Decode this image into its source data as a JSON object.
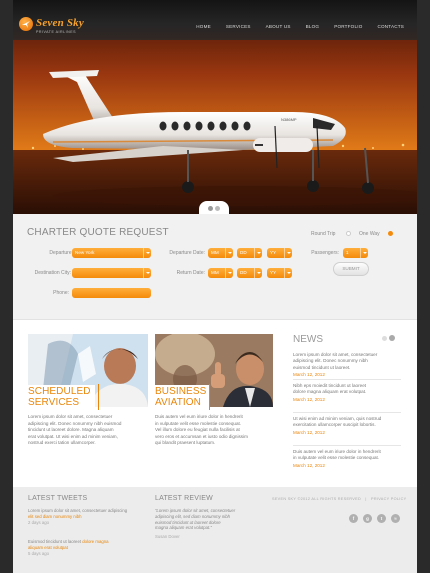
{
  "brand": {
    "name": "Seven Sky",
    "tagline": "PRIVATE AIRLINES"
  },
  "nav": [
    "HOME",
    "SERVICES",
    "ABOUT US",
    "BLOG",
    "PORTFOLIO",
    "CONTACTS"
  ],
  "aircraft_tail": "N386MP",
  "quote": {
    "title": "CHARTER QUOTE REQUEST",
    "trip_round": "Round Trip",
    "trip_oneway": "One Way",
    "departure_city_label": "Departure City:",
    "departure_city_value": "New York",
    "destination_city_label": "Destination City:",
    "phone_label": "Phone:",
    "departure_date_label": "Departure Date:",
    "return_date_label": "Return Date:",
    "mm": "MM",
    "dd": "DD",
    "yy": "YY",
    "passengers_label": "Passengers:",
    "passengers_value": "1",
    "submit": "SUBMIT"
  },
  "cards": [
    {
      "title_line1": "SCHEDULED",
      "title_line2": "SERVICES",
      "text": [
        "Lorem ipsum dolor sit amet, consectetuer",
        "adipiscing elit. Donec nonummy nibh euismod",
        "tincidunt ut laoreet dolore. Magna aliquam",
        "erat volutpat. Ut wisi enim ad minim veniam,",
        "nostrud exerci tation ullamcorper."
      ]
    },
    {
      "title_line1": "BUSINESS",
      "title_line2": "AVIATION",
      "text": [
        "Duis autem vel eum iriure dolor in hendrerit",
        "in vulputate velit esse molestie consequat.",
        "Vel illum dolore eu feugiat nulla facilisis at",
        "vero eros et accumsan et iusto odio dignissim",
        "qui blandit praesent luptatum."
      ]
    }
  ],
  "news": {
    "title": "NEWS",
    "items": [
      {
        "text": [
          "Lorem ipsum dolor sit amet, consectetuer",
          "adipiscing elit. Donec nonummy nibh",
          "euismod tincidunt ut laoreet."
        ],
        "date": "March 12, 2012"
      },
      {
        "text": [
          "Nibh eps moiedit tincidunt ut laoreet",
          "dolore magna aliquam erat volutpat."
        ],
        "date": "March 12, 2012"
      },
      {
        "text": [
          "Ut wisi enim ad minim veniam, quis nostrud",
          "exercitation ullamcorper suscipit lobortis."
        ],
        "date": "March 12, 2012"
      },
      {
        "text": [
          "Duis autem vel eum iriure dolor in hendrerit",
          "in vulputate velit esse molestie consequat."
        ],
        "date": "March 12, 2012"
      }
    ]
  },
  "footer": {
    "tweets_title": "LATEST TWEETS",
    "tweet1_a": "Lorem ipsum dolor sit amet, consectetuer adipiscing",
    "tweet1_b": "elit",
    "tweet1_c": "sed diam nonummy nibh",
    "tweet1_time": "2 days ago",
    "tweet2_a": "Euismod tincidunt ut laoreet",
    "tweet2_b": "dolore magna",
    "tweet2_c": "aliquam erat volutpat",
    "tweet2_time": "5 days ago",
    "review_title": "LATEST REVIEW",
    "review_text": [
      "“Lorem ipsum dolor sit amet, consectetuer",
      "adipiscing elit, sed diam nonummy nibh",
      "euismod tincidunt ut laoreet dolore",
      "magna aliquam erat volutpat.”"
    ],
    "review_author": "Susan Dover",
    "copyright": "SEVEN SKY ©2012 ALL RIGHTS RESERVED",
    "privacy": "PRIVACY POLICY",
    "social": [
      "facebook-icon",
      "google-plus-icon",
      "twitter-icon",
      "rss-icon"
    ]
  },
  "colors": {
    "accent": "#f48a0b",
    "header_dark": "#1e1e1e",
    "panel_bg": "#f1f1f1"
  }
}
